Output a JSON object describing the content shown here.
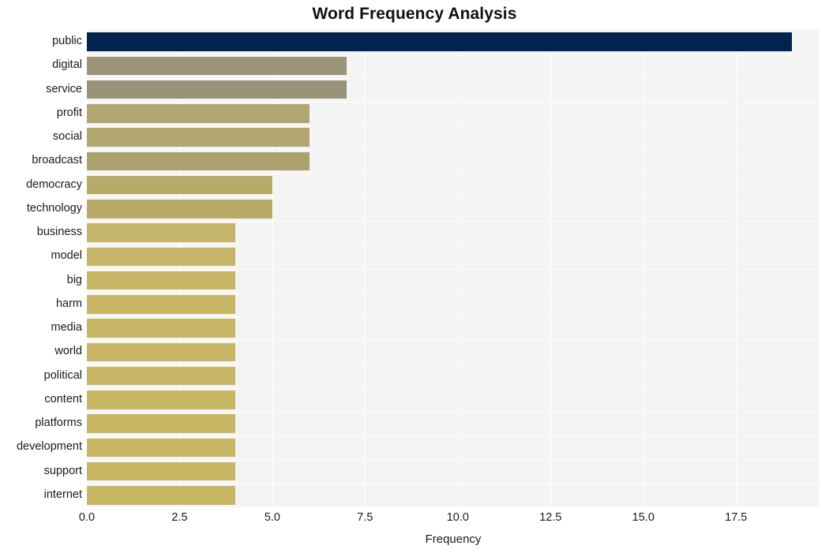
{
  "chart_data": {
    "type": "bar",
    "orientation": "horizontal",
    "title": "Word Frequency Analysis",
    "xlabel": "Frequency",
    "ylabel": "",
    "categories": [
      "public",
      "digital",
      "service",
      "profit",
      "social",
      "broadcast",
      "democracy",
      "technology",
      "business",
      "model",
      "big",
      "harm",
      "media",
      "world",
      "political",
      "content",
      "platforms",
      "development",
      "support",
      "internet"
    ],
    "values": [
      19,
      7,
      7,
      6,
      6,
      6,
      5,
      5,
      4,
      4,
      4,
      4,
      4,
      4,
      4,
      4,
      4,
      4,
      4,
      4
    ],
    "bar_colors": [
      "#00234f",
      "#9a9478",
      "#9a9278",
      "#b2a670",
      "#b2a670",
      "#aca26f",
      "#b8ab6a",
      "#b8ab6a",
      "#c4b568",
      "#c4b568",
      "#c6b666",
      "#c6b666",
      "#c6b666",
      "#c6b666",
      "#c6b666",
      "#c7b765",
      "#c7b765",
      "#c7b765",
      "#c7b765",
      "#c7b765"
    ],
    "xlim": [
      0.0,
      19.75
    ],
    "ylim_count": 20,
    "xticks": [
      0.0,
      2.5,
      5.0,
      7.5,
      10.0,
      12.5,
      15.0,
      17.5
    ],
    "xtick_labels": [
      "0.0",
      "2.5",
      "5.0",
      "7.5",
      "10.0",
      "12.5",
      "15.0",
      "17.5"
    ],
    "grid": true,
    "grid_axis": "both",
    "grid_color": "#ffffff",
    "plot_background": "#f4f4f4",
    "figure_background": "#ffffff",
    "legend": null
  },
  "title": {
    "text": "Word Frequency Analysis"
  },
  "axes": {
    "x_title": "Frequency"
  }
}
